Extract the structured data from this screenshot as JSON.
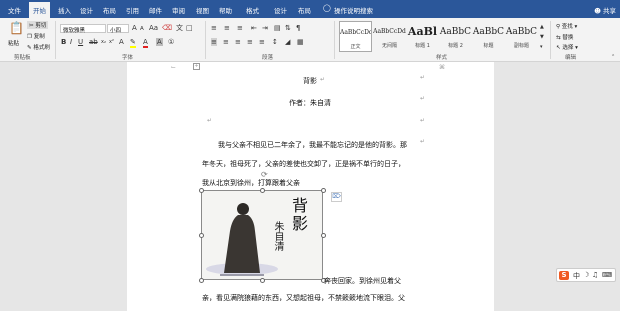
{
  "tabs": [
    "文件",
    "开始",
    "插入",
    "设计",
    "布局",
    "引用",
    "邮件",
    "审阅",
    "视图",
    "帮助",
    "格式",
    "设计",
    "布局"
  ],
  "tell_me": "操作说明搜索",
  "share": "共享",
  "ribbon": {
    "clipboard": {
      "paste": "粘贴",
      "cut": "剪切",
      "copy": "复制",
      "format_painter": "格式刷",
      "label": "剪贴板"
    },
    "font": {
      "name": "微软雅黑",
      "size": "小四",
      "label": "字体"
    },
    "paragraph": {
      "label": "段落"
    },
    "styles": {
      "label": "样式",
      "items": [
        {
          "preview": "AaBbCcDd",
          "name": "正文"
        },
        {
          "preview": "AaBbCcDd",
          "name": "无间隔"
        },
        {
          "preview": "AaBl",
          "name": "标题 1"
        },
        {
          "preview": "AaBbC",
          "name": "标题 2"
        },
        {
          "preview": "AaBbC",
          "name": "标题"
        },
        {
          "preview": "AaBbC",
          "name": "副标题"
        }
      ]
    },
    "editing": {
      "find": "查找",
      "replace": "替换",
      "select": "选择",
      "label": "编辑"
    }
  },
  "document": {
    "title": "背影",
    "author": "作者：朱自清",
    "p1": "我与父亲不相见已二年余了，我最不能忘记的是他的背影。那",
    "p2": "年冬天，祖母死了，父亲的差使也交卸了，正是祸不单行的日子，",
    "p3": "我从北京到徐州，打算跟着父亲",
    "p4_tail": "奔丧回家。到徐州见着父",
    "p5": "亲，看见满院狼藉的东西，又想起祖母，不禁簌簌地流下眼泪。父",
    "image_title": "背影",
    "image_author": "朱自清"
  },
  "ime": {
    "label": "S"
  },
  "colors": {
    "ribbon_blue": "#2b579a",
    "ime_orange": "#f05a22"
  }
}
